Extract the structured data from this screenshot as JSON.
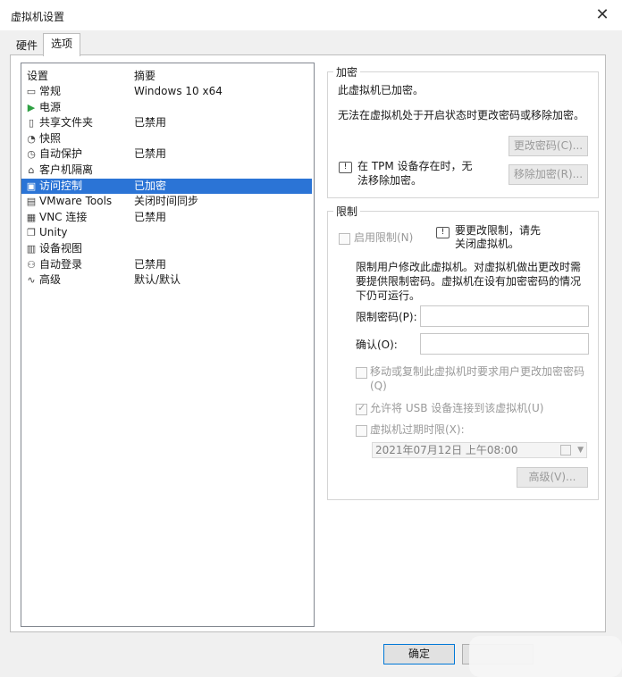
{
  "window": {
    "title": "虚拟机设置",
    "close_glyph": "✕"
  },
  "tabs": [
    {
      "label": "硬件"
    },
    {
      "label": "选项"
    }
  ],
  "settings_list": {
    "header": {
      "setting": "设置",
      "summary": "摘要"
    },
    "rows": [
      {
        "icon": "general-icon",
        "glyph": "▭",
        "label": "常规",
        "summary": "Windows 10 x64"
      },
      {
        "icon": "power-icon",
        "glyph": "▶",
        "label": "电源",
        "summary": ""
      },
      {
        "icon": "shared-folders-icon",
        "glyph": "▯",
        "label": "共享文件夹",
        "summary": "已禁用"
      },
      {
        "icon": "snapshot-icon",
        "glyph": "◔",
        "label": "快照",
        "summary": ""
      },
      {
        "icon": "autoprotect-icon",
        "glyph": "◷",
        "label": "自动保护",
        "summary": "已禁用"
      },
      {
        "icon": "guest-isolation-icon",
        "glyph": "⌂",
        "label": "客户机隔离",
        "summary": ""
      },
      {
        "icon": "access-control-icon",
        "glyph": "▣",
        "label": "访问控制",
        "summary": "已加密"
      },
      {
        "icon": "vmware-tools-icon",
        "glyph": "▤",
        "label": "VMware Tools",
        "summary": "关闭时间同步"
      },
      {
        "icon": "vnc-icon",
        "glyph": "▦",
        "label": "VNC 连接",
        "summary": "已禁用"
      },
      {
        "icon": "unity-icon",
        "glyph": "❐",
        "label": "Unity",
        "summary": ""
      },
      {
        "icon": "appliance-view-icon",
        "glyph": "▥",
        "label": "设备视图",
        "summary": ""
      },
      {
        "icon": "autologin-icon",
        "glyph": "⚇",
        "label": "自动登录",
        "summary": "已禁用"
      },
      {
        "icon": "advanced-icon",
        "glyph": "∿",
        "label": "高级",
        "summary": "默认/默认"
      }
    ],
    "selected_index": 6
  },
  "encryption": {
    "title": "加密",
    "status": "此虚拟机已加密。",
    "note": "无法在虚拟机处于开启状态时更改密码或移除加密。",
    "change_password_btn": "更改密码(C)...",
    "tpm_note": [
      "在 TPM 设备存在时，无",
      "法移除加密。"
    ],
    "remove_encryption_btn": "移除加密(R)..."
  },
  "restrictions": {
    "title": "限制",
    "enable_label": "启用限制(N)",
    "hint": [
      "要更改限制，请先",
      "关闭虚拟机。"
    ],
    "description": [
      "限制用户修改此虚拟机。对虚拟机做出更改时需",
      "要提供限制密码。虚拟机在设有加密密码的情况",
      "下仍可运行。"
    ],
    "password_label": "限制密码(P):",
    "confirm_label": "确认(O):",
    "require_change_label": [
      "移动或复制此虚拟机时要求用户更改加密密码",
      "(Q)"
    ],
    "allow_usb_label": "允许将 USB 设备连接到该虚拟机(U)",
    "expire_label": "虚拟机过期时限(X):",
    "expire_date": "2021年07月12日  上午08:00",
    "advanced_btn": "高级(V)..."
  },
  "footer": {
    "ok_label": "确定"
  }
}
